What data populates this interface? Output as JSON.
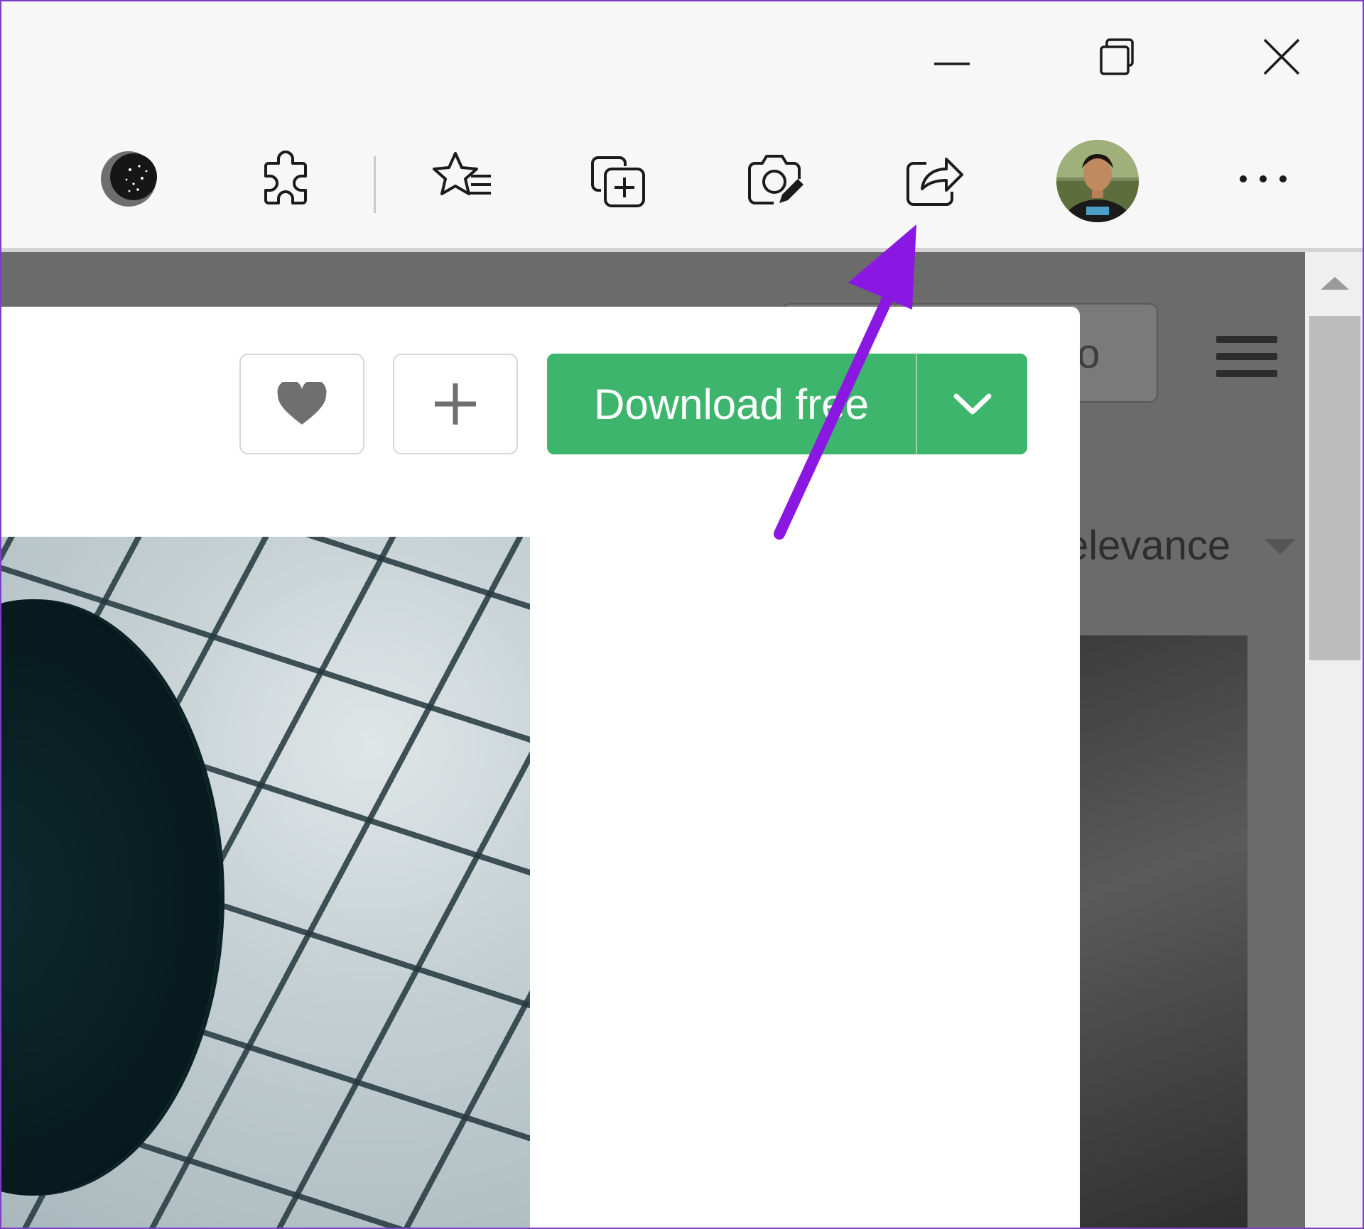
{
  "window_controls": {
    "minimize_icon": "minimize-icon",
    "restore_icon": "restore-icon",
    "close_icon": "close-icon"
  },
  "toolbar": {
    "buttons": [
      {
        "icon": "dark-reader-moon-icon",
        "label": ""
      },
      {
        "icon": "extensions-puzzle-icon",
        "label": ""
      },
      {
        "icon": "favorites-star-list-icon",
        "label": ""
      },
      {
        "icon": "collections-add-icon",
        "label": ""
      },
      {
        "icon": "web-capture-camera-icon",
        "label": ""
      },
      {
        "icon": "share-icon",
        "label": ""
      },
      {
        "icon": "profile-avatar",
        "label": ""
      },
      {
        "icon": "more-dots-icon",
        "label": ""
      }
    ]
  },
  "background_page": {
    "partial_button_text": "to",
    "sort_partial_text": "elevance"
  },
  "modal": {
    "like_icon": "heart-icon",
    "collect_icon": "plus-icon",
    "download_label": "Download free",
    "download_caret_icon": "chevron-down-icon"
  },
  "annotation": {
    "arrow_color": "#8b17e3",
    "points_to": "share-icon"
  },
  "colors": {
    "download_green": "#3eb56d",
    "overlay": "#6b6b6b",
    "frame": "#7e3cc7"
  }
}
